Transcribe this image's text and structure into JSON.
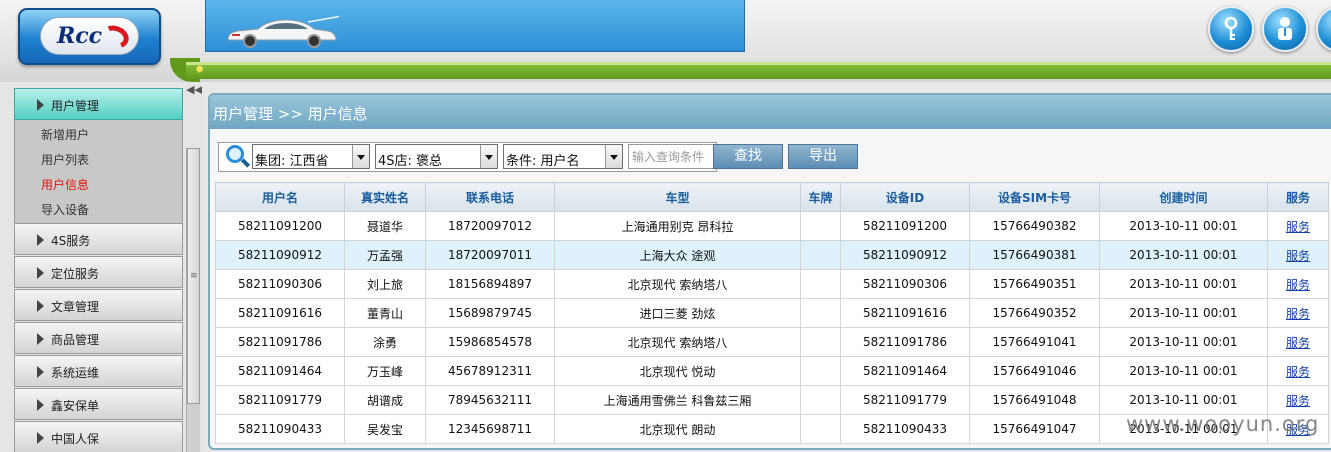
{
  "header": {
    "logo_text": "Rcc",
    "icons": [
      "key-icon",
      "user-icon",
      "edit-icon"
    ]
  },
  "sidebar": {
    "menus": [
      {
        "label": "用户管理",
        "active": true
      },
      {
        "label": "4S服务"
      },
      {
        "label": "定位服务"
      },
      {
        "label": "文章管理"
      },
      {
        "label": "商品管理"
      },
      {
        "label": "系统运维"
      },
      {
        "label": "鑫安保单"
      },
      {
        "label": "中国人保"
      }
    ],
    "submenu": [
      {
        "label": "新增用户"
      },
      {
        "label": "用户列表"
      },
      {
        "label": "用户信息",
        "active": true
      },
      {
        "label": "导入设备"
      }
    ]
  },
  "main": {
    "title": "用户管理 >> 用户信息",
    "search": {
      "group_select": "集团: 江西省",
      "store_select": "4S店: 褒总",
      "condition_select": "条件: 用户名",
      "query_placeholder": "输入查询条件",
      "search_button": "查找",
      "export_button": "导出"
    },
    "table": {
      "columns": [
        "用户名",
        "真实姓名",
        "联系电话",
        "车型",
        "车牌",
        "设备ID",
        "设备SIM卡号",
        "创建时间",
        "服务"
      ],
      "rows": [
        [
          "58211091200",
          "聂道华",
          "18720097012",
          "上海通用别克 昂科拉",
          "",
          "58211091200",
          "15766490382",
          "2013-10-11 00:01",
          "服务"
        ],
        [
          "58211090912",
          "万孟强",
          "18720097011",
          "上海大众 途观",
          "",
          "58211090912",
          "15766490381",
          "2013-10-11 00:01",
          "服务"
        ],
        [
          "58211090306",
          "刘上旅",
          "18156894897",
          "北京现代 索纳塔八",
          "",
          "58211090306",
          "15766490351",
          "2013-10-11 00:01",
          "服务"
        ],
        [
          "58211091616",
          "董青山",
          "15689879745",
          "进口三菱 劲炫",
          "",
          "58211091616",
          "15766490352",
          "2013-10-11 00:01",
          "服务"
        ],
        [
          "58211091786",
          "涂勇",
          "15986854578",
          "北京现代 索纳塔八",
          "",
          "58211091786",
          "15766491041",
          "2013-10-11 00:01",
          "服务"
        ],
        [
          "58211091464",
          "万玉峰",
          "45678912311",
          "北京现代 悦动",
          "",
          "58211091464",
          "15766491046",
          "2013-10-11 00:01",
          "服务"
        ],
        [
          "58211091779",
          "胡谱成",
          "78945632111",
          "上海通用雪佛兰 科鲁兹三厢",
          "",
          "58211091779",
          "15766491048",
          "2013-10-11 00:01",
          "服务"
        ],
        [
          "58211090433",
          "吴发宝",
          "12345698711",
          "北京现代 朗动",
          "",
          "58211090433",
          "15766491047",
          "2013-10-11 00:01",
          "服务"
        ]
      ],
      "highlighted_row": 1
    }
  },
  "watermark": "www.wooyun.org",
  "colors": {
    "accent": "#6fa6c1",
    "active_menu": "#52cfc3",
    "header_text": "#1b5fa0",
    "active_sub": "#e8120a",
    "green_bar": "#6ea82a"
  }
}
